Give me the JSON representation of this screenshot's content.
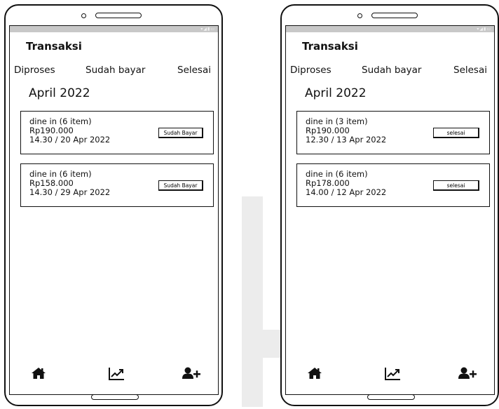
{
  "phones": [
    {
      "title": "Transaksi",
      "tabs": [
        "Diproses",
        "Sudah bayar",
        "Selesai"
      ],
      "month": "April 2022",
      "cards": [
        {
          "line1": "dine in (6 item)",
          "line2": "Rp190.000",
          "line3": "14.30 / 20 Apr 2022",
          "button": "Sudah Bayar"
        },
        {
          "line1": "dine in (6 item)",
          "line2": "Rp158.000",
          "line3": "14.30 / 29 Apr 2022",
          "button": "Sudah Bayar"
        }
      ],
      "nav": [
        "home-icon",
        "chart-trend-icon",
        "add-user-icon"
      ]
    },
    {
      "title": "Transaksi",
      "tabs": [
        "Diproses",
        "Sudah bayar",
        "Selesai"
      ],
      "month": "April 2022",
      "cards": [
        {
          "line1": "dine in (3 item)",
          "line2": "Rp190.000",
          "line3": "12.30 / 13 Apr 2022",
          "button": "selesai"
        },
        {
          "line1": "dine in (6 item)",
          "line2": "Rp178.000",
          "line3": "14.00 / 12 Apr 2022",
          "button": "selesai"
        }
      ],
      "nav": [
        "home-icon",
        "chart-trend-icon",
        "add-user-icon"
      ]
    }
  ]
}
